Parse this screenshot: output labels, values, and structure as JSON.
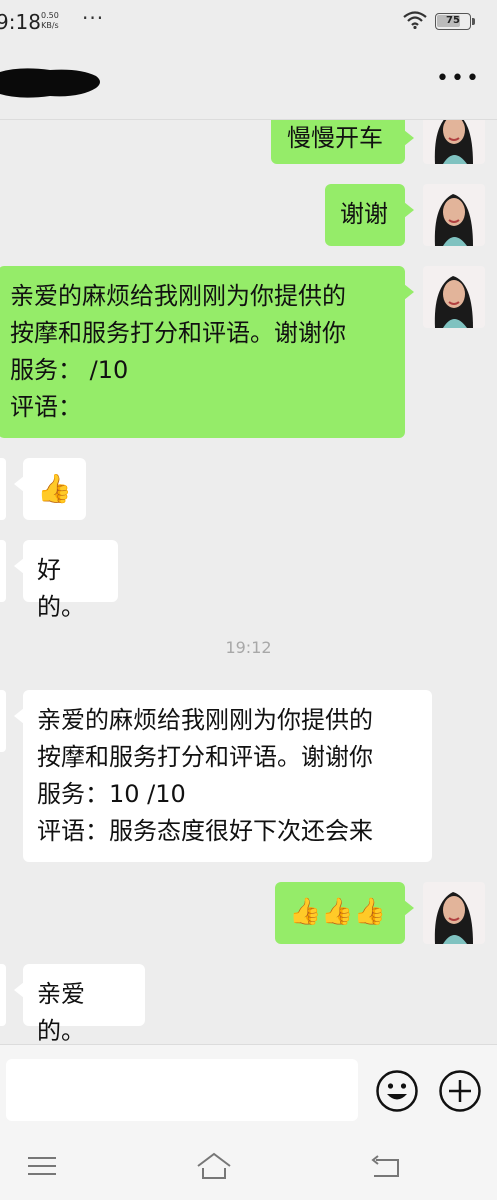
{
  "status_bar": {
    "time": "9:18",
    "speed_value": "0.50",
    "speed_unit": "KB/s",
    "notif_dots": "···",
    "battery": "75",
    "battery_level": 0.75
  },
  "header": {
    "title_redacted": true,
    "more_icon": "more-dots-icon"
  },
  "messages": [
    {
      "side": "right",
      "text": "慢慢开车"
    },
    {
      "side": "right",
      "text": "谢谢"
    },
    {
      "side": "right",
      "text": "亲爱的麻烦给我刚刚为你提供的\n按摩和服务打分和评语。谢谢你\n服务： /10\n评语："
    },
    {
      "side": "left",
      "text": "👍"
    },
    {
      "side": "left",
      "text": "好的。"
    },
    {
      "timestamp": "19:12"
    },
    {
      "side": "left",
      "text": "亲爱的麻烦给我刚刚为你提供的\n按摩和服务打分和评语。谢谢你\n服务：10 /10\n评语：服务态度很好下次还会来"
    },
    {
      "side": "right",
      "text": "👍👍👍"
    },
    {
      "side": "left",
      "text": "亲爱的。"
    }
  ],
  "input_bar": {
    "input_value": "",
    "emoji_icon": "emoji-smile-icon",
    "plus_icon": "plus-circle-icon"
  },
  "nav_bar": {
    "menu_icon": "menu-lines-icon",
    "home_icon": "home-icon",
    "back_icon": "back-arrow-icon"
  },
  "colors": {
    "my_bubble": "#95ec69",
    "their_bubble": "#ffffff",
    "background": "#ededed"
  }
}
